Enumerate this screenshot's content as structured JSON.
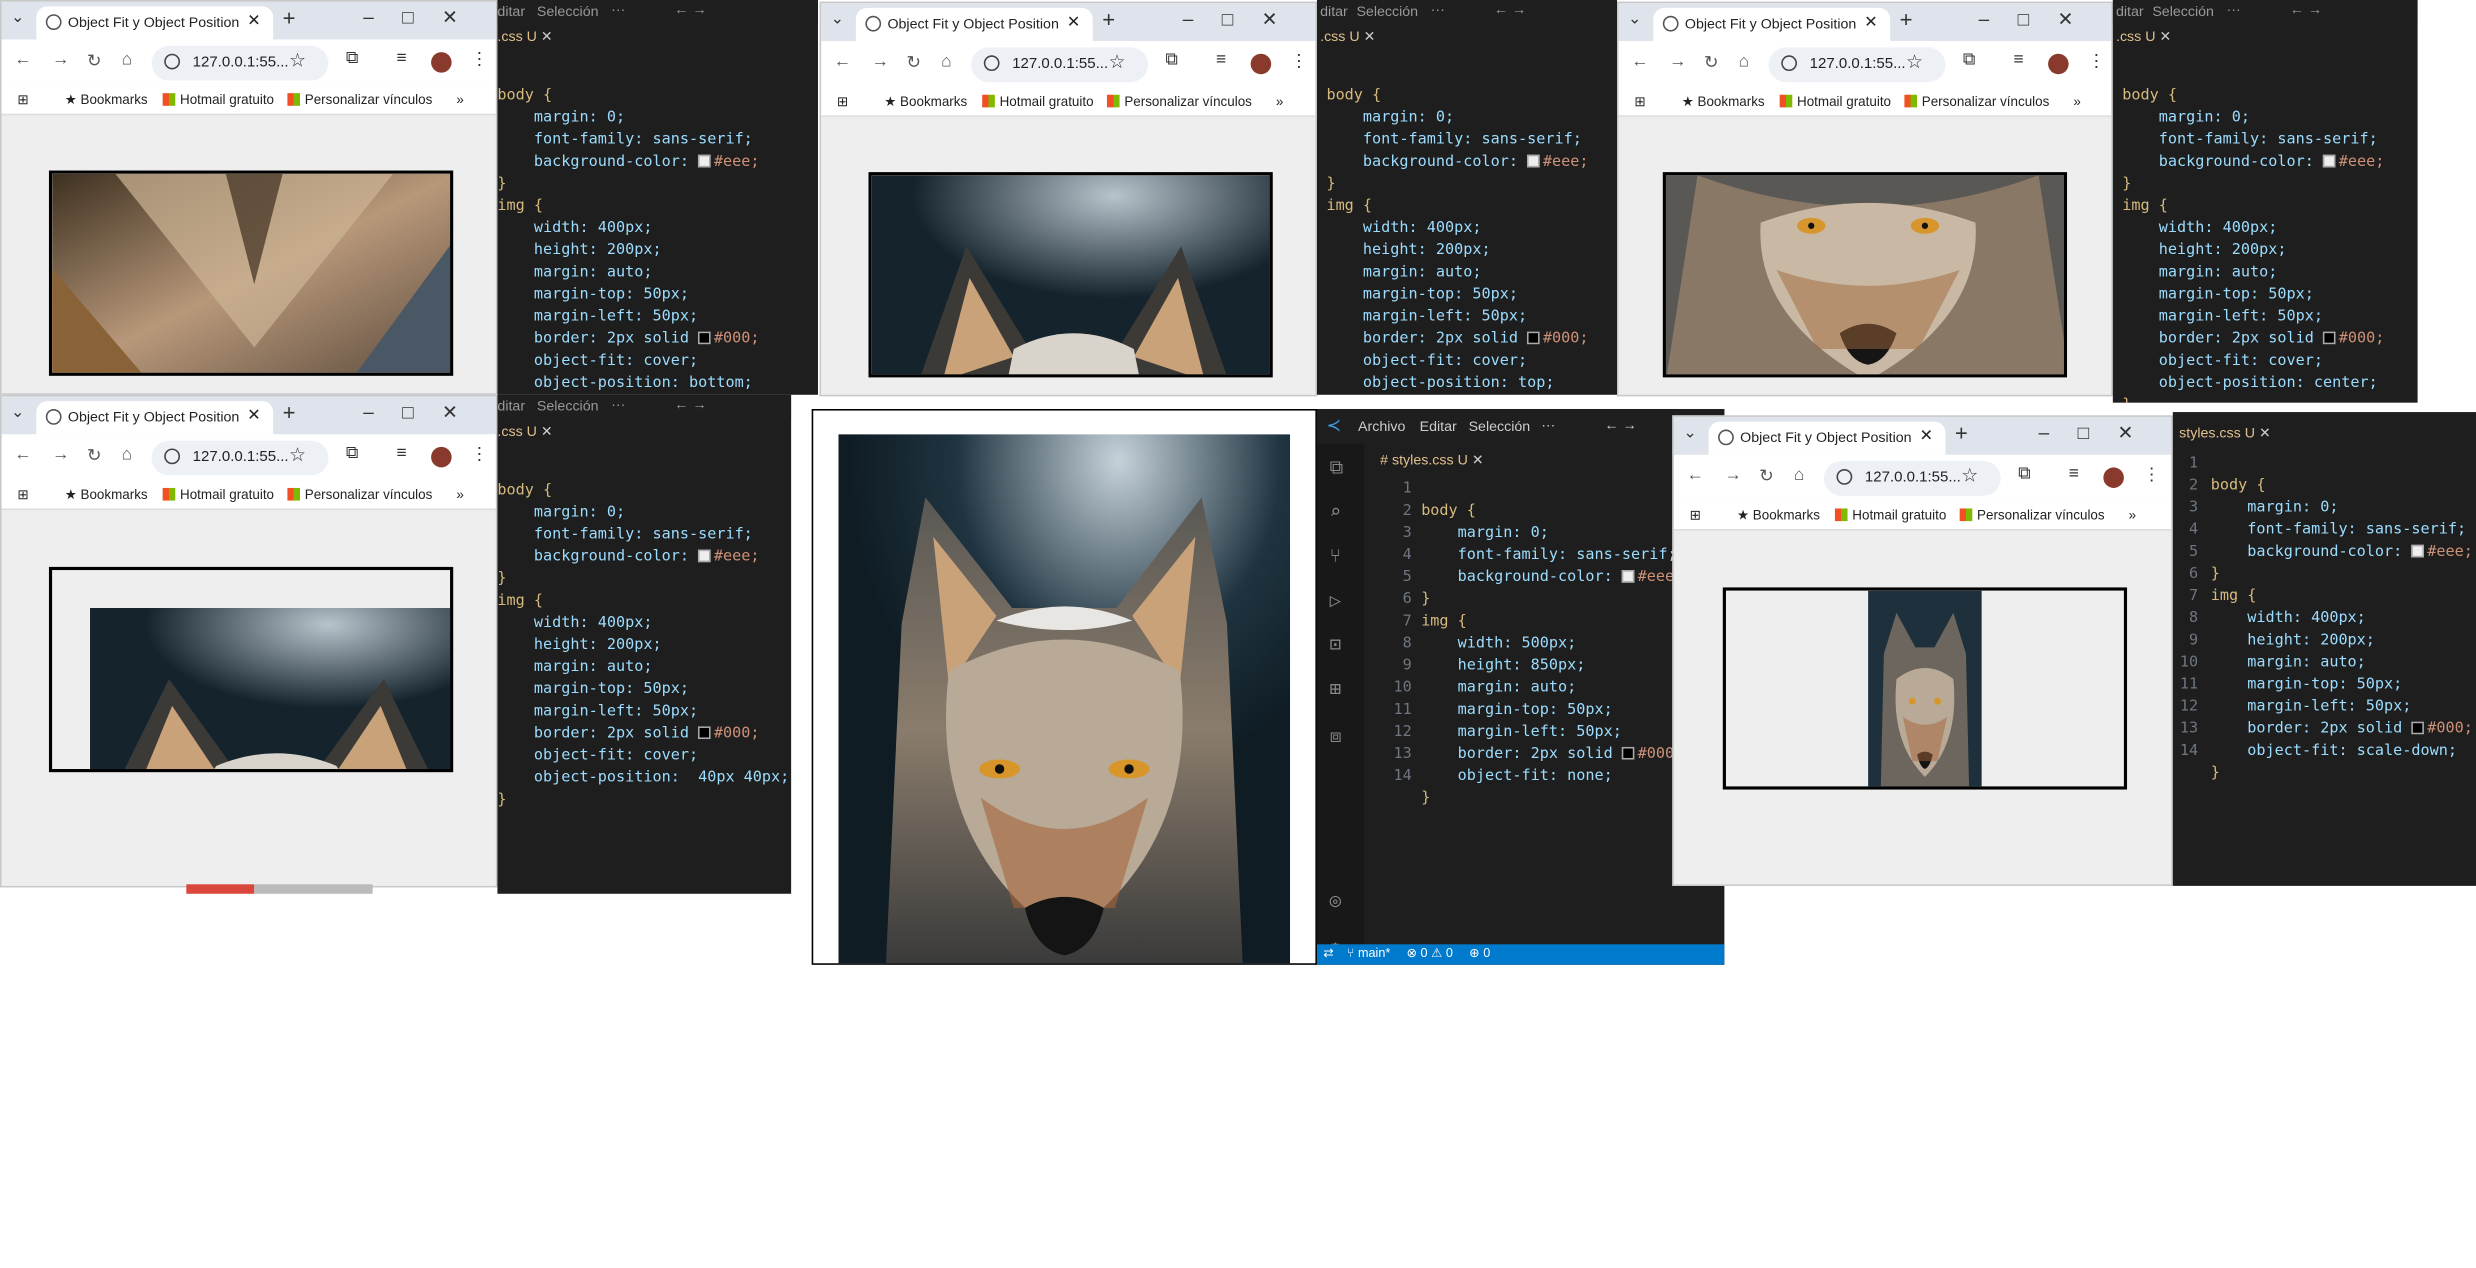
{
  "browser": {
    "tab_title": "Object Fit y Object Position",
    "url": "127.0.0.1:55...",
    "bookmarks": [
      "Bookmarks",
      "Hotmail gratuito",
      "Personalizar vínculos"
    ]
  },
  "editor": {
    "menu": [
      "Archivo",
      "Editar",
      "Selección"
    ],
    "menu_partial": "ditar",
    "file_tab": "styles.css",
    "file_tab_partial": ".css",
    "modified": "U",
    "status": {
      "branch": "main*",
      "problems": "⊗ 0 ⚠ 0",
      "ports": "⊕ 0"
    }
  },
  "code": {
    "body_sel": "body {",
    "margin": "margin: 0;",
    "font": "font-family: sans-serif;",
    "bg": "background-color:",
    "bg_val": "#eee;",
    "close": "}",
    "img_sel": "img {",
    "width_400": "width: 400px;",
    "height_200": "height: 200px;",
    "width_500": "width: 500px;",
    "height_850": "height: 850px;",
    "margin_auto": "margin: auto;",
    "margin_top": "margin-top: 50px;",
    "margin_left": "margin-left: 50px;",
    "border": "border: 2px solid",
    "border_val": "#000;",
    "fit_cover": "object-fit: cover;",
    "fit_none": "object-fit: none;",
    "fit_scale": "object-fit: scale-down;",
    "pos_bottom": "object-position: bottom;",
    "pos_top": "object-position: top;",
    "pos_center": "object-position: center;",
    "pos_40": "object-position:  40px 40px;"
  },
  "colors": {
    "editor_bg": "#1e1e1e",
    "accent": "#007acc",
    "browser_bg": "#eeeeee"
  },
  "icons": [
    "globe-icon",
    "close-icon",
    "back-icon",
    "forward-icon",
    "reload-icon",
    "home-icon",
    "info-icon",
    "star-icon",
    "extensions-icon",
    "avatar",
    "ms-icon"
  ]
}
